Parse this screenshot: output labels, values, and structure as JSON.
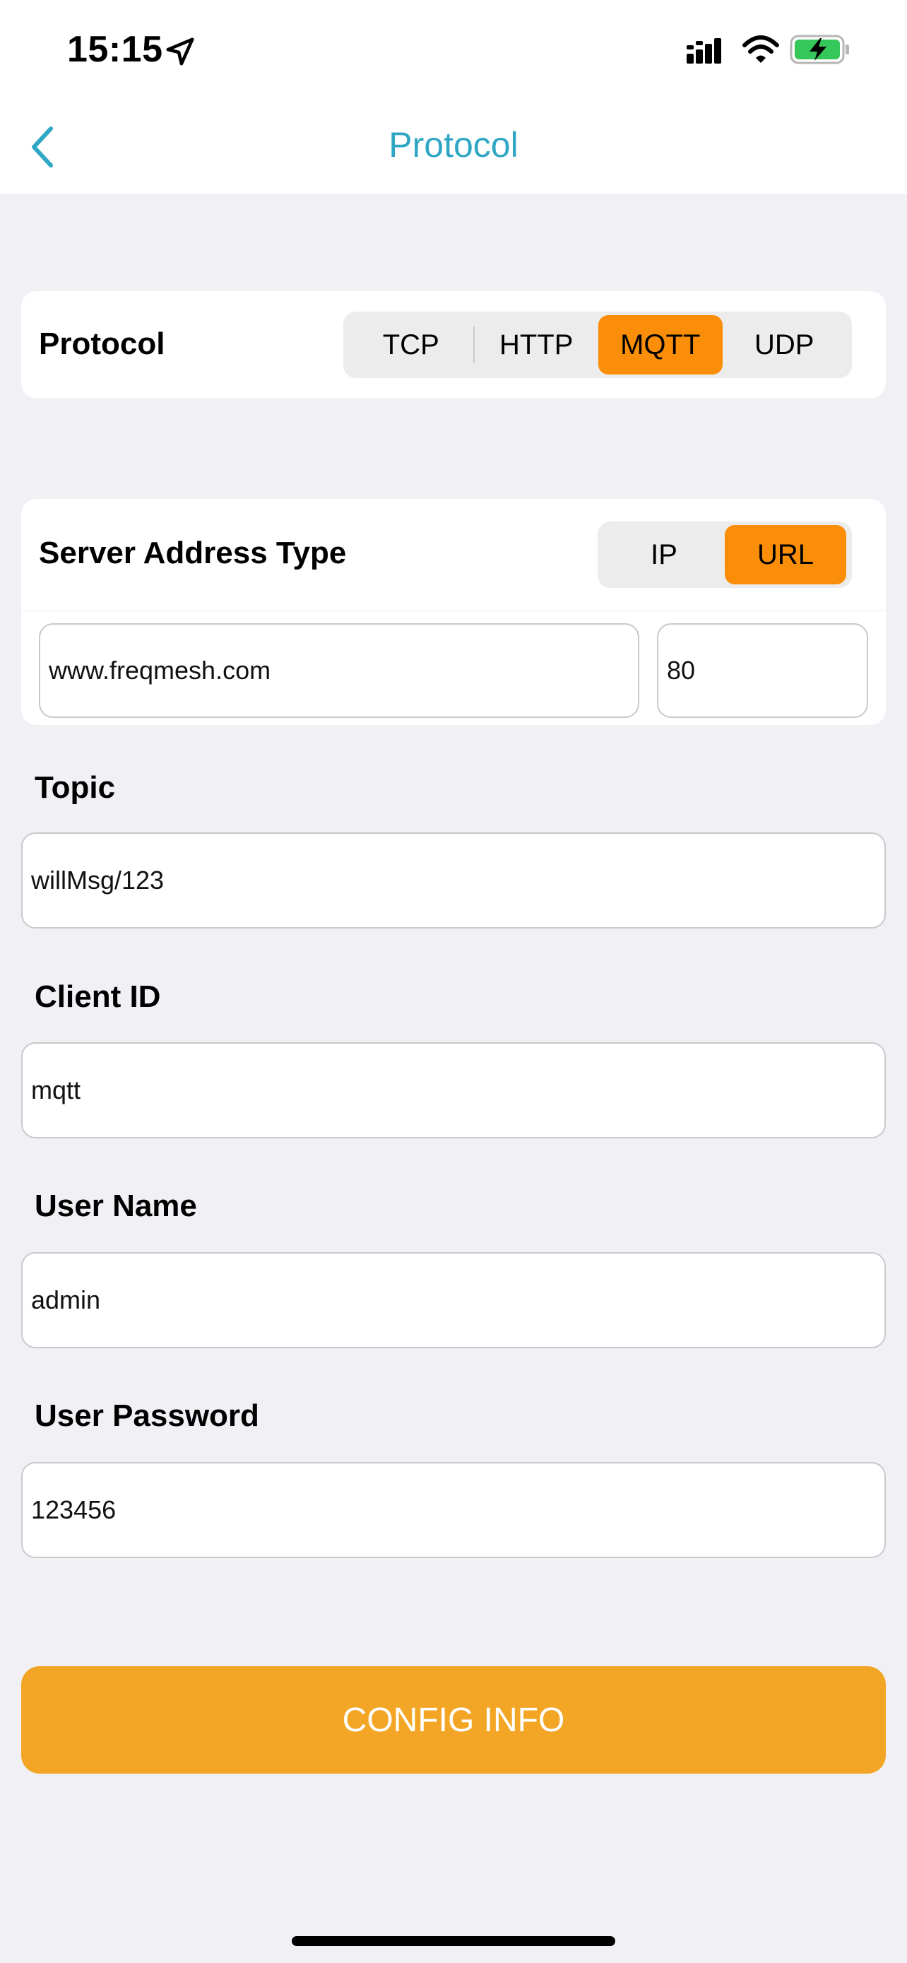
{
  "status_bar": {
    "time": "15:15",
    "icons": [
      "location-arrow-icon",
      "cellular-signal-icon",
      "wifi-icon",
      "battery-charging-icon"
    ]
  },
  "nav": {
    "title": "Protocol",
    "back_icon": "chevron-left-icon",
    "accent_color": "#2fa7c4"
  },
  "protocol": {
    "label": "Protocol",
    "options": [
      "TCP",
      "HTTP",
      "MQTT",
      "UDP"
    ],
    "selected": "MQTT"
  },
  "server": {
    "label": "Server Address Type",
    "options": [
      "IP",
      "URL"
    ],
    "selected": "URL",
    "address": "www.freqmesh.com",
    "port": "80"
  },
  "fields": {
    "topic": {
      "label": "Topic",
      "value": "willMsg/123"
    },
    "client_id": {
      "label": "Client ID",
      "value": "mqtt"
    },
    "user_name": {
      "label": "User Name",
      "value": "admin"
    },
    "user_password": {
      "label": "User Password",
      "value": "123456"
    }
  },
  "actions": {
    "config_label": "CONFIG INFO"
  },
  "colors": {
    "selected_segment": "#fa8e08",
    "button": "#f3a626",
    "background": "#f0f0f5"
  }
}
